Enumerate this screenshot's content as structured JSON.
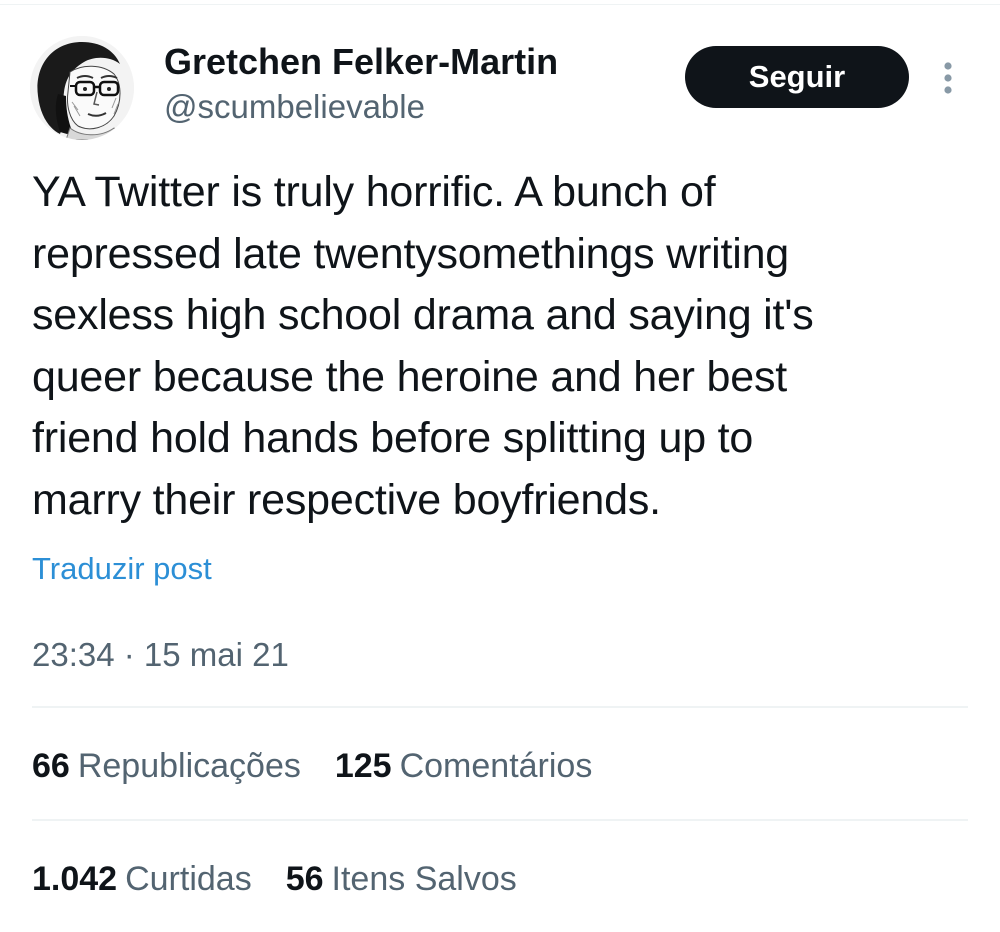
{
  "author": {
    "display_name": "Gretchen Felker-Martin",
    "handle": "@scumbelievable",
    "avatar_icon": "sketched-portrait-avatar"
  },
  "actions": {
    "follow_label": "Seguir",
    "more_icon": "vertical-ellipsis-icon"
  },
  "post": {
    "text": "YA Twitter is truly horrific. A bunch of\nrepressed late twentysomethings writing\nsexless high school drama and saying it's\nqueer because the heroine and her best\nfriend hold hands before splitting up to\nmarry their respective boyfriends.",
    "translate_label": "Traduzir post",
    "timestamp": "23:34 · 15 mai 21"
  },
  "stats": {
    "reposts": {
      "count": "66",
      "label": "Republicações"
    },
    "comments": {
      "count": "125",
      "label": "Comentários"
    },
    "likes": {
      "count": "1.042",
      "label": "Curtidas"
    },
    "bookmarks": {
      "count": "56",
      "label": "Itens Salvos"
    }
  },
  "colors": {
    "text_primary": "#0f1419",
    "text_secondary": "#536471",
    "link": "#2c8fd6",
    "button_bg": "#0f1419",
    "divider": "#eff3f4"
  }
}
